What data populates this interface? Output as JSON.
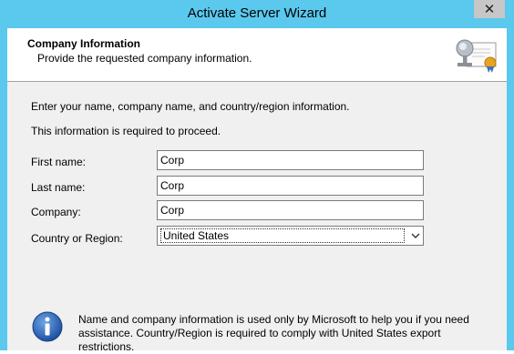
{
  "window": {
    "title": "Activate Server Wizard",
    "close_glyph": "✕"
  },
  "header": {
    "title": "Company Information",
    "subtitle": "Provide the requested company information.",
    "icon": "certificate-icon"
  },
  "intro": {
    "line1": "Enter your name, company name, and country/region information.",
    "line2": "This information is required to proceed."
  },
  "form": {
    "first_name_label": "First name:",
    "first_name_value": "Corp",
    "last_name_label": "Last name:",
    "last_name_value": "Corp",
    "company_label": "Company:",
    "company_value": "Corp",
    "country_label": "Country or Region:",
    "country_value": "United States"
  },
  "info": {
    "icon": "info-icon",
    "text": "Name and company information is used only by Microsoft to help you if you need assistance. Country/Region is required to comply with United States export restrictions."
  }
}
